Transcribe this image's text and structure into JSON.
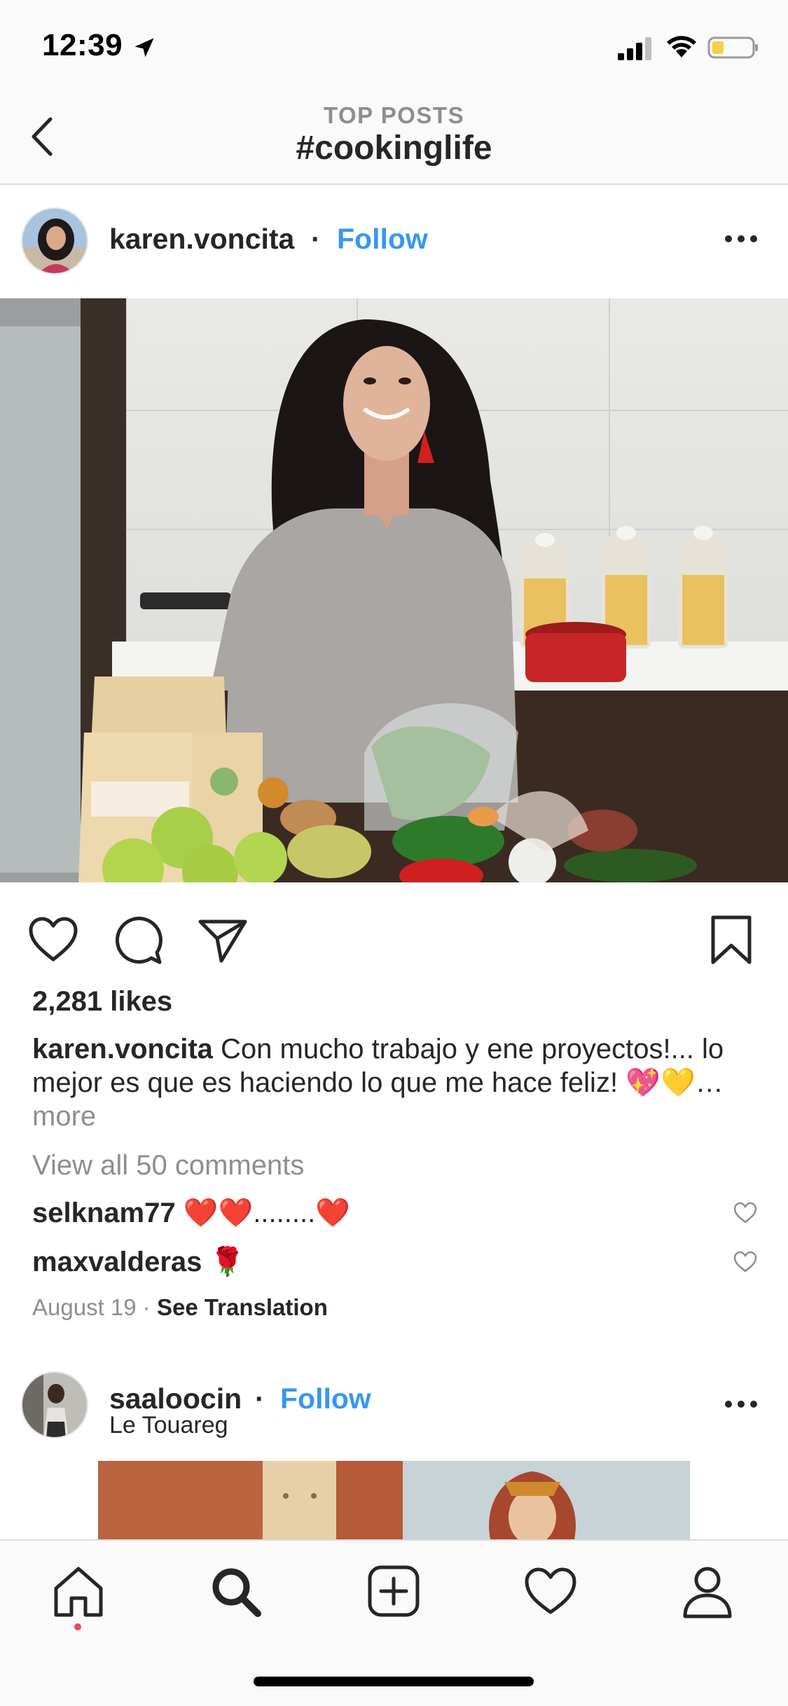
{
  "status_bar": {
    "time": "12:39",
    "battery_color": "#f2d14b"
  },
  "nav": {
    "subtitle": "TOP POSTS",
    "title": "#cookinglife"
  },
  "post": {
    "username": "karen.voncita",
    "separator": "·",
    "follow_label": "Follow",
    "likes": "2,281 likes",
    "caption_user": "karen.voncita",
    "caption_text": " Con mucho trabajo y ene proyectos!... lo mejor es que es haciendo lo que me hace feliz! 💖💛",
    "caption_more_prefix": "… ",
    "caption_more": "more",
    "view_comments": "View all 50 comments",
    "comments": [
      {
        "user": "selknam77",
        "text": " ❤️❤️........❤️"
      },
      {
        "user": "maxvalderas",
        "text": " 🌹"
      }
    ],
    "date": "August 19",
    "date_separator": " · ",
    "see_translation": "See Translation"
  },
  "post2": {
    "username": "saaloocin",
    "separator": "·",
    "follow_label": "Follow",
    "location": "Le Touareg"
  },
  "colors": {
    "link_blue": "#3897f0",
    "muted_gray": "#8e8e8e",
    "text_dark": "#262626",
    "notification_dot": "#ed4956"
  },
  "icons": {
    "back": "chevron-left-icon",
    "more": "more-horizontal-icon",
    "like": "heart-icon",
    "comment": "comment-bubble-icon",
    "share": "paper-plane-icon",
    "save": "bookmark-icon",
    "tabs": [
      "home-icon",
      "search-icon",
      "add-post-icon",
      "activity-heart-icon",
      "profile-icon"
    ]
  }
}
